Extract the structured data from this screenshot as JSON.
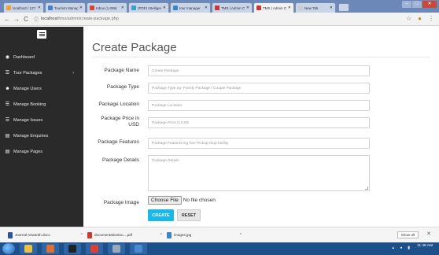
{
  "browser": {
    "tabs": [
      {
        "label": "localhost / 127.0",
        "color": "#f0a030",
        "active": false
      },
      {
        "label": "Tourism Manag",
        "color": "#4a7fd0",
        "active": false
      },
      {
        "label": "Inbox (1,059)",
        "color": "#d44638",
        "active": false
      },
      {
        "label": "(PDF) Intelligen",
        "color": "#3aa0c8",
        "active": false
      },
      {
        "label": "tour manager",
        "color": "#3a86c8",
        "active": false
      },
      {
        "label": "TMS | Admin C",
        "color": "#d2342e",
        "active": false
      },
      {
        "label": "TMS | Admin C",
        "color": "#d2342e",
        "active": true
      },
      {
        "label": "New Tab",
        "color": "#cccccc",
        "active": false
      }
    ],
    "url_host": "localhost",
    "url_path": "/tms/admin/create-package.php",
    "back_icon": "back-arrow-icon",
    "forward_icon": "forward-arrow-icon",
    "reload_icon": "reload-icon"
  },
  "sidebar": {
    "items": [
      {
        "label": "Dashboard",
        "icon": "dashboard-icon",
        "glyph": "◉"
      },
      {
        "label": "Tour Packages",
        "icon": "list-icon",
        "glyph": "☰",
        "chevron": "›"
      },
      {
        "label": "Manage Users",
        "icon": "users-icon",
        "glyph": "☻"
      },
      {
        "label": "Manage Booking",
        "icon": "list-icon",
        "glyph": "☰"
      },
      {
        "label": "Manage Issues",
        "icon": "list-icon",
        "glyph": "☰"
      },
      {
        "label": "Manage Enquiries",
        "icon": "file-icon",
        "glyph": "▤"
      },
      {
        "label": "Manage Pages",
        "icon": "file-icon",
        "glyph": "▤"
      }
    ]
  },
  "main": {
    "title": "Create Package",
    "fields": [
      {
        "label": "Package Name",
        "placeholder": "Create Package"
      },
      {
        "label": "Package Type",
        "placeholder": "Package Type eg- Family Package / Couple Package"
      },
      {
        "label": "Package Location",
        "placeholder": "Package Location"
      },
      {
        "label": "Package Price in USD",
        "placeholder": "Package Price is USD"
      },
      {
        "label": "Package Features",
        "placeholder": "Package Features Eg free Pickup-drop facility"
      },
      {
        "label": "Package Details",
        "placeholder": "Package Details"
      }
    ],
    "image_label": "Package Image",
    "choose_file": "Choose File",
    "no_file": "No file chosen",
    "create_button": "CREATE",
    "reset_button": "RESET"
  },
  "downloads": {
    "items": [
      {
        "name": "Journal Aswanth.docx",
        "color": "#2b5797"
      },
      {
        "name": "documentationtou....pdf",
        "color": "#d2342e"
      },
      {
        "name": "images.jpg",
        "color": "#3a86c8"
      }
    ],
    "show_all": "Show all"
  },
  "taskbar": {
    "apps": [
      {
        "name": "explorer",
        "color": "#f0c040"
      },
      {
        "name": "media",
        "color": "#e07030"
      },
      {
        "name": "terminal",
        "color": "#222222"
      },
      {
        "name": "chrome",
        "color": "#e04030"
      },
      {
        "name": "settings",
        "color": "#9aa8b8"
      },
      {
        "name": "photos",
        "color": "#4a8ad0"
      }
    ],
    "time": "11:48 AM"
  }
}
